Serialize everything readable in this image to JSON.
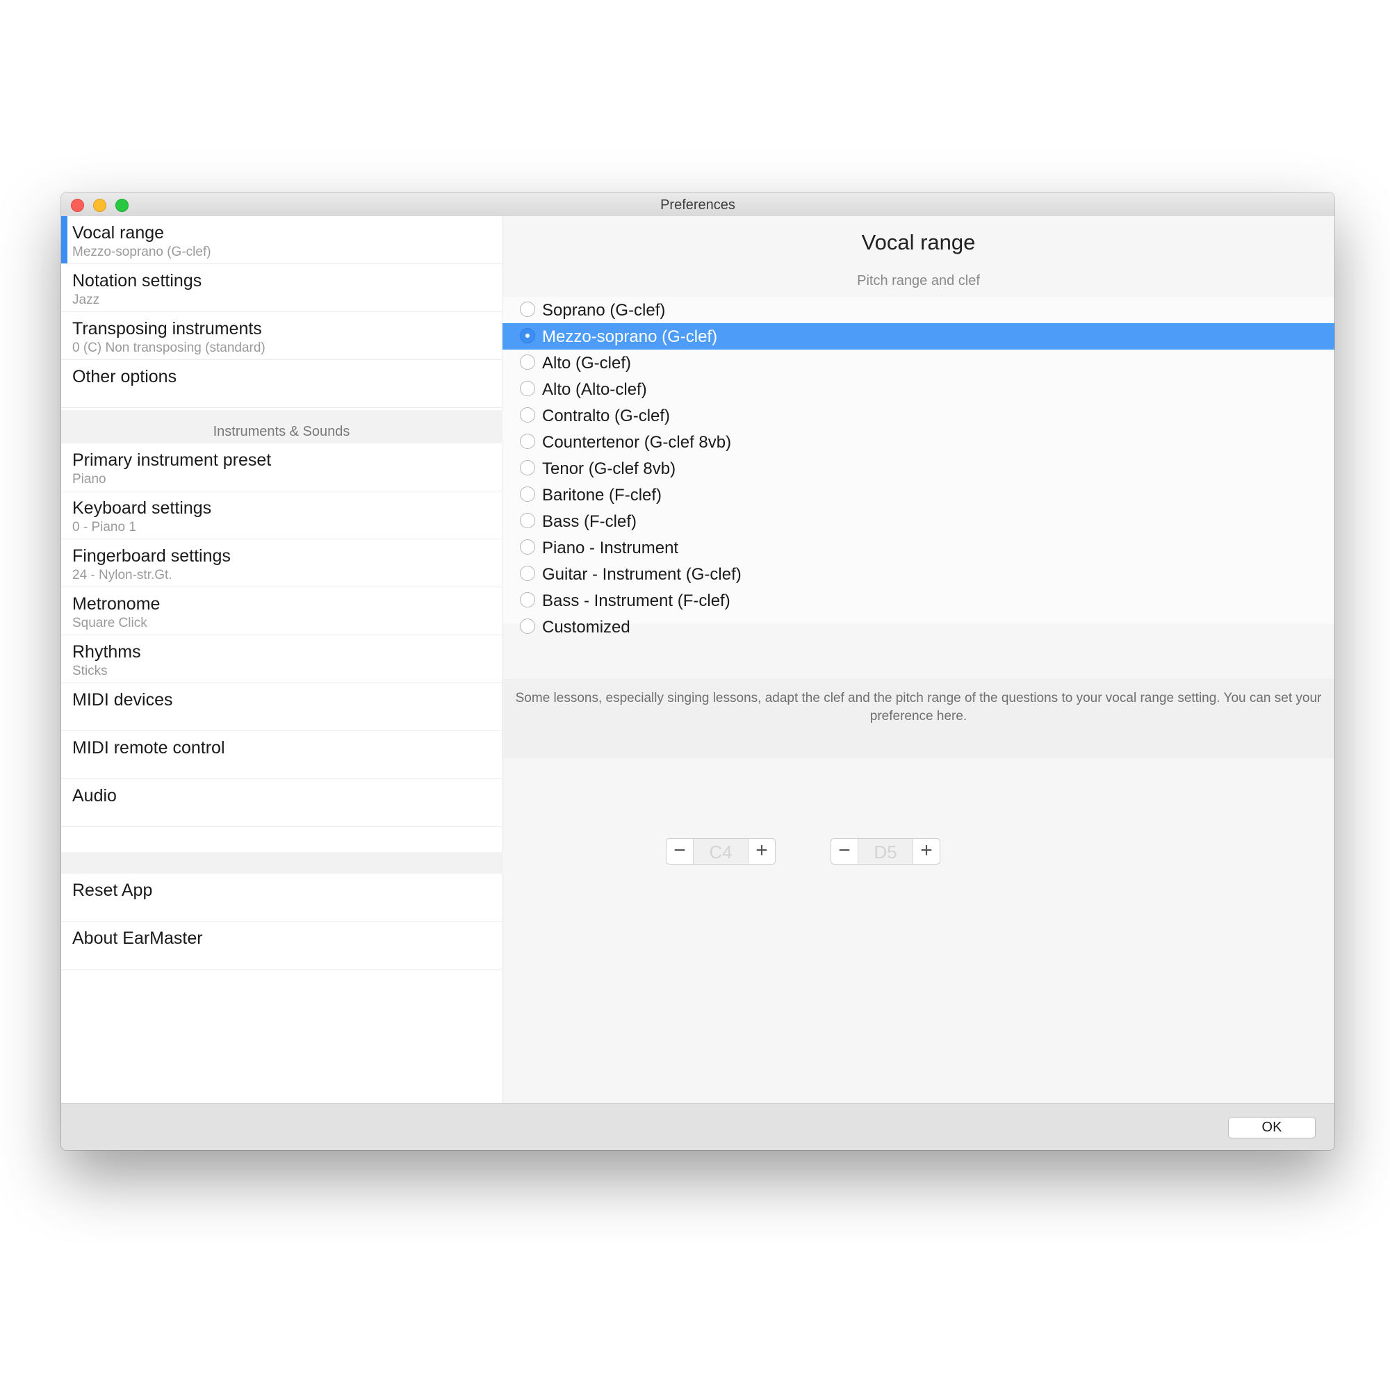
{
  "window": {
    "title": "Preferences"
  },
  "sidebar": {
    "items": [
      {
        "label": "Vocal range",
        "sub": "Mezzo-soprano (G-clef)"
      },
      {
        "label": "Notation settings",
        "sub": "Jazz"
      },
      {
        "label": "Transposing instruments",
        "sub": "0 (C) Non transposing (standard)"
      },
      {
        "label": "Other options",
        "sub": ""
      }
    ],
    "section_title": "Instruments & Sounds",
    "instrument_items": [
      {
        "label": "Primary instrument preset",
        "sub": "Piano"
      },
      {
        "label": "Keyboard settings",
        "sub": "0 - Piano 1"
      },
      {
        "label": "Fingerboard settings",
        "sub": "24 - Nylon-str.Gt."
      },
      {
        "label": "Metronome",
        "sub": "Square Click"
      },
      {
        "label": "Rhythms",
        "sub": "Sticks"
      },
      {
        "label": "MIDI devices",
        "sub": ""
      },
      {
        "label": "MIDI remote control",
        "sub": ""
      },
      {
        "label": "Audio",
        "sub": ""
      }
    ],
    "app_items": [
      {
        "label": "Reset App"
      },
      {
        "label": "About EarMaster"
      }
    ]
  },
  "content": {
    "title": "Vocal range",
    "subtitle": "Pitch range and clef",
    "options": [
      "Soprano (G-clef)",
      "Mezzo-soprano (G-clef)",
      "Alto (G-clef)",
      "Alto (Alto-clef)",
      "Contralto (G-clef)",
      "Countertenor (G-clef 8vb)",
      "Tenor (G-clef 8vb)",
      "Baritone (F-clef)",
      "Bass (F-clef)",
      "Piano - Instrument",
      "Guitar - Instrument (G-clef)",
      "Bass - Instrument (F-clef)",
      "Customized"
    ],
    "selected_option": "Mezzo-soprano (G-clef)",
    "low_note": "C4",
    "high_note": "D5",
    "description": "Some lessons, especially singing lessons, adapt the clef and the pitch range of the questions to your vocal range setting. You can set your preference here."
  },
  "footer": {
    "ok_label": "OK"
  },
  "colors": {
    "accent": "#3d8ef3",
    "selection": "#4d9df8"
  }
}
